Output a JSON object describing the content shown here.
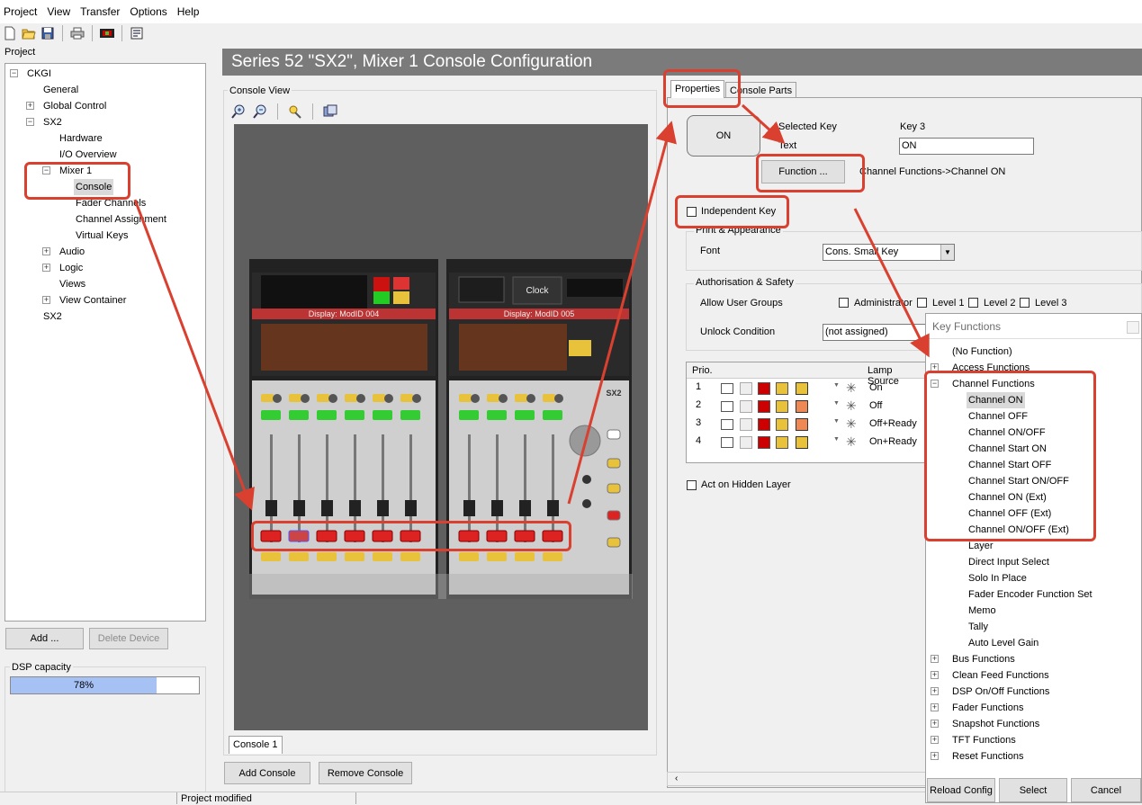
{
  "menu": [
    "Project",
    "View",
    "Transfer",
    "Options",
    "Help"
  ],
  "toolbar": {
    "icons": [
      "new-icon",
      "open-icon",
      "save-icon",
      "print-icon",
      "device-icon",
      "config-icon"
    ]
  },
  "project": {
    "label": "Project",
    "tree": [
      {
        "text": "CKGI",
        "level": 0,
        "toggle": "-"
      },
      {
        "text": "General",
        "level": 1,
        "toggle": ""
      },
      {
        "text": "Global Control",
        "level": 1,
        "toggle": "+"
      },
      {
        "text": "SX2",
        "level": 1,
        "toggle": "-"
      },
      {
        "text": "Hardware",
        "level": 2,
        "toggle": ""
      },
      {
        "text": "I/O Overview",
        "level": 2,
        "toggle": ""
      },
      {
        "text": "Mixer 1",
        "level": 2,
        "toggle": "-"
      },
      {
        "text": "Console",
        "level": 3,
        "toggle": "",
        "selected": true
      },
      {
        "text": "Fader Channels",
        "level": 3,
        "toggle": ""
      },
      {
        "text": "Channel Assignment",
        "level": 3,
        "toggle": ""
      },
      {
        "text": "Virtual Keys",
        "level": 3,
        "toggle": ""
      },
      {
        "text": "Audio",
        "level": 2,
        "toggle": "+"
      },
      {
        "text": "Logic",
        "level": 2,
        "toggle": "+"
      },
      {
        "text": "Views",
        "level": 2,
        "toggle": ""
      },
      {
        "text": "View Container",
        "level": 2,
        "toggle": "+"
      },
      {
        "text": "SX2",
        "level": 1,
        "toggle": ""
      }
    ],
    "add_label": "Add ...",
    "delete_label": "Delete Device",
    "dsp_label": "DSP capacity",
    "dsp_value": "78%",
    "dsp_fraction": 0.78
  },
  "status": {
    "text": "Project modified"
  },
  "title": "Series 52 \"SX2\", Mixer 1 Console Configuration",
  "console_view": {
    "label": "Console View",
    "tab": "Console 1",
    "add_label": "Add Console",
    "remove_label": "Remove Console",
    "display_left": "Display: ModID 004",
    "display_right": "Display: ModID 005",
    "clock": "Clock",
    "brand": "SX2"
  },
  "properties": {
    "tab_properties": "Properties",
    "tab_console_parts": "Console Parts",
    "key_preview": "ON",
    "selected_key_label": "Selected Key",
    "selected_key_value": "Key 3",
    "text_label": "Text",
    "text_value": "ON",
    "function_button": "Function ...",
    "function_value": "Channel Functions->Channel ON",
    "independent_key": "Independent Key",
    "print_appearance": "Print & Appearance",
    "font_label": "Font",
    "font_value": "Cons. Small Key",
    "auth_label": "Authorisation & Safety",
    "allow_groups": "Allow User Groups",
    "groups": [
      "Administrator",
      "Level 1",
      "Level 2",
      "Level 3"
    ],
    "unlock_label": "Unlock Condition",
    "unlock_value": "(not assigned)",
    "prio_header": "Prio.",
    "lamp_header": "Lamp Source",
    "lamps": [
      {
        "prio": "1",
        "label": "On"
      },
      {
        "prio": "2",
        "label": "Off"
      },
      {
        "prio": "3",
        "label": "Off+Ready"
      },
      {
        "prio": "4",
        "label": "On+Ready"
      }
    ],
    "act_hidden": "Act on Hidden Layer"
  },
  "key_functions": {
    "title": "Key Functions",
    "items": [
      {
        "text": "(No Function)",
        "level": 0,
        "toggle": ""
      },
      {
        "text": "Access Functions",
        "level": 0,
        "toggle": "+"
      },
      {
        "text": "Channel Functions",
        "level": 0,
        "toggle": "-"
      },
      {
        "text": "Channel ON",
        "level": 1,
        "toggle": "",
        "selected": true
      },
      {
        "text": "Channel OFF",
        "level": 1,
        "toggle": ""
      },
      {
        "text": "Channel ON/OFF",
        "level": 1,
        "toggle": ""
      },
      {
        "text": "Channel Start ON",
        "level": 1,
        "toggle": ""
      },
      {
        "text": "Channel Start OFF",
        "level": 1,
        "toggle": ""
      },
      {
        "text": "Channel Start ON/OFF",
        "level": 1,
        "toggle": ""
      },
      {
        "text": "Channel ON (Ext)",
        "level": 1,
        "toggle": ""
      },
      {
        "text": "Channel OFF (Ext)",
        "level": 1,
        "toggle": ""
      },
      {
        "text": "Channel ON/OFF (Ext)",
        "level": 1,
        "toggle": ""
      },
      {
        "text": "Layer",
        "level": 1,
        "toggle": ""
      },
      {
        "text": "Direct Input Select",
        "level": 1,
        "toggle": ""
      },
      {
        "text": "Solo In Place",
        "level": 1,
        "toggle": ""
      },
      {
        "text": "Fader Encoder Function Set",
        "level": 1,
        "toggle": ""
      },
      {
        "text": "Memo",
        "level": 1,
        "toggle": ""
      },
      {
        "text": "Tally",
        "level": 1,
        "toggle": ""
      },
      {
        "text": "Auto Level Gain",
        "level": 1,
        "toggle": ""
      },
      {
        "text": "Bus Functions",
        "level": 0,
        "toggle": "+"
      },
      {
        "text": "Clean Feed Functions",
        "level": 0,
        "toggle": "+"
      },
      {
        "text": "DSP On/Off Functions",
        "level": 0,
        "toggle": "+"
      },
      {
        "text": "Fader Functions",
        "level": 0,
        "toggle": "+"
      },
      {
        "text": "Snapshot Functions",
        "level": 0,
        "toggle": "+"
      },
      {
        "text": "TFT Functions",
        "level": 0,
        "toggle": "+"
      },
      {
        "text": "Reset Functions",
        "level": 0,
        "toggle": "+"
      }
    ],
    "reload_label": "Reload Config",
    "select_label": "Select",
    "cancel_label": "Cancel"
  },
  "colors": {
    "annotation": "#d9402f",
    "selection": "#cce8ff",
    "progress": "#a6c2f5"
  }
}
